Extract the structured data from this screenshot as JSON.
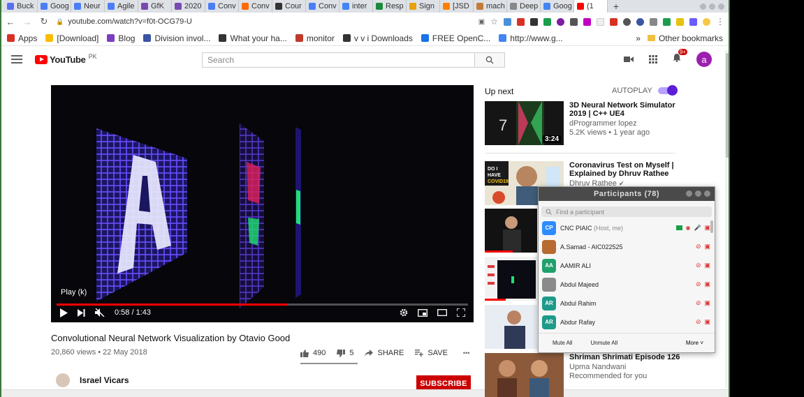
{
  "browser": {
    "tabs": [
      {
        "label": "Buck",
        "color": "#5a6ef0"
      },
      {
        "label": "Goog",
        "color": "#4a7ef7"
      },
      {
        "label": "Neur",
        "color": "#4a7ef7"
      },
      {
        "label": "Agile",
        "color": "#4a7ef7"
      },
      {
        "label": "GfK",
        "color": "#7a4ab0"
      },
      {
        "label": "2020",
        "color": "#7a4ab0"
      },
      {
        "label": "Conv",
        "color": "#4a7ef7"
      },
      {
        "label": "Conv",
        "color": "#ff6a00"
      },
      {
        "label": "Cour",
        "color": "#333333"
      },
      {
        "label": "Conv",
        "color": "#4a7ef7"
      },
      {
        "label": "inter",
        "color": "#4285f4"
      },
      {
        "label": "Resp",
        "color": "#1c8a3c"
      },
      {
        "label": "Sign",
        "color": "#e8a10c"
      },
      {
        "label": "[JSD",
        "color": "#ff7f00"
      },
      {
        "label": "mach",
        "color": "#c47a3a"
      },
      {
        "label": "Deep",
        "color": "#888888"
      },
      {
        "label": "Goog",
        "color": "#4285f4"
      },
      {
        "label": "(1",
        "color": "#ff0000"
      }
    ],
    "url": "youtube.com/watch?v=f0t-OCG79-U",
    "bookmarks": [
      {
        "label": "Apps",
        "color": "#d93025"
      },
      {
        "label": "[Download]",
        "color": "#fbbc04"
      },
      {
        "label": "Blog",
        "color": "#7b3fbf"
      },
      {
        "label": "Division invol...",
        "color": "#3b54a4"
      },
      {
        "label": "What your ha...",
        "color": "#333333"
      },
      {
        "label": "monitor",
        "color": "#c0392b"
      },
      {
        "label": "v v i Downloads",
        "color": "#333333"
      },
      {
        "label": "FREE OpenC...",
        "color": "#1a73e8"
      },
      {
        "label": "http://www.g...",
        "color": "#4285f4"
      }
    ],
    "other_bookmarks": "Other bookmarks",
    "more_glyph": "»"
  },
  "youtube": {
    "logo_word": "YouTube",
    "country": "PK",
    "search_placeholder": "Search",
    "notification_count": "9+",
    "avatar_letter": "a"
  },
  "player": {
    "play_tooltip": "Play (k)",
    "time": "0:58 / 1:43",
    "progress_fraction": 0.56
  },
  "video": {
    "title": "Convolutional Neural Network Visualization by Otavio Good",
    "stats": "20,860 views • 22 May 2018",
    "likes": "490",
    "dislikes": "5",
    "share": "SHARE",
    "save": "SAVE",
    "more": "•••",
    "channel": "Israel Vicars",
    "subscribe": "SUBSCRIBE"
  },
  "upnext": {
    "label": "Up next",
    "autoplay": "AUTOPLAY",
    "items": [
      {
        "title": "3D Neural Network Simulator 2019 | C++ UE4",
        "channel": "dProgrammer lopez",
        "meta": "5.2K views • 1 year ago",
        "duration": "3:24"
      },
      {
        "title": "Coronavirus Test on Myself | Explained by Dhruv Rathee",
        "channel": "Dhruv Rathee",
        "meta": ""
      },
      {
        "title": "Shriman Shrimati Episode 126",
        "channel": "Upma Nandwani",
        "meta": "Recommended for you"
      }
    ]
  },
  "zoom": {
    "title": "Participants (78)",
    "search_placeholder": "Find a participant",
    "participants": [
      {
        "initials": "CP",
        "name": "CNC PIAIC",
        "note": "(Host, me)",
        "color": "#2d8cff"
      },
      {
        "initials": "",
        "name": "A.Samad - AIC022525",
        "note": "",
        "color": "#b76a32"
      },
      {
        "initials": "AA",
        "name": "AAMIR ALI",
        "note": "",
        "color": "#22a06b"
      },
      {
        "initials": "",
        "name": "Abdul Majeed",
        "note": "",
        "color": "#8a8a8a"
      },
      {
        "initials": "AR",
        "name": "Abdul Rahim",
        "note": "",
        "color": "#1e9a8a"
      },
      {
        "initials": "AR",
        "name": "Abdur Rafay",
        "note": "",
        "color": "#1e9a8a"
      }
    ],
    "mute_all": "Mute All",
    "unmute_all": "Unmute All",
    "more": "More"
  }
}
